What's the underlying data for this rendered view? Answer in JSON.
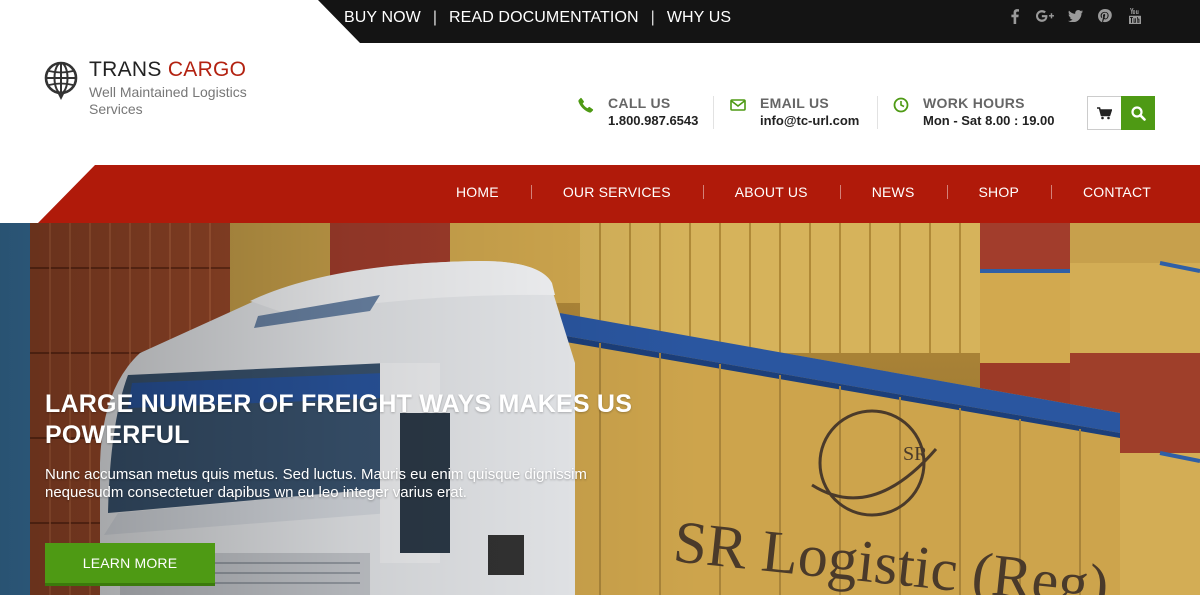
{
  "topbar": {
    "links": [
      "BUY NOW",
      "READ DOCUMENTATION",
      "WHY US"
    ],
    "separator": "|",
    "social_icons": [
      "facebook-icon",
      "google-plus-icon",
      "twitter-icon",
      "pinterest-icon",
      "youtube-icon"
    ]
  },
  "logo": {
    "title_part1": "TRANS ",
    "title_part2": "CARGO",
    "subtitle": "Well Maintained Logistics Services",
    "icon": "globe-icon"
  },
  "contact": {
    "call": {
      "label": "CALL US",
      "value": "1.800.987.6543",
      "icon": "phone-icon"
    },
    "email": {
      "label": "EMAIL US",
      "value": "info@tc-url.com",
      "icon": "envelope-icon"
    },
    "hours": {
      "label": "WORK HOURS",
      "value": "Mon - Sat 8.00 : 19.00",
      "icon": "clock-icon"
    }
  },
  "nav": {
    "items": [
      "HOME",
      "OUR SERVICES",
      "ABOUT US",
      "NEWS",
      "SHOP",
      "CONTACT"
    ]
  },
  "hero": {
    "title": "LARGE NUMBER OF FREIGHT WAYS MAKES US POWERFUL",
    "description": "Nunc accumsan metus quis metus. Sed luctus. Mauris eu enim quisque dignissim nequesudm consectetuer dapibus wn eu leo integer varius erat.",
    "button_label": "LEARN MORE",
    "truck_text": "SR Logistic (Reg)",
    "truck_badge": "SR"
  },
  "colors": {
    "topbar": "#141414",
    "brand_red": "#b01a0a",
    "accent_green": "#4e9a14",
    "logo_accent": "#b32211"
  }
}
